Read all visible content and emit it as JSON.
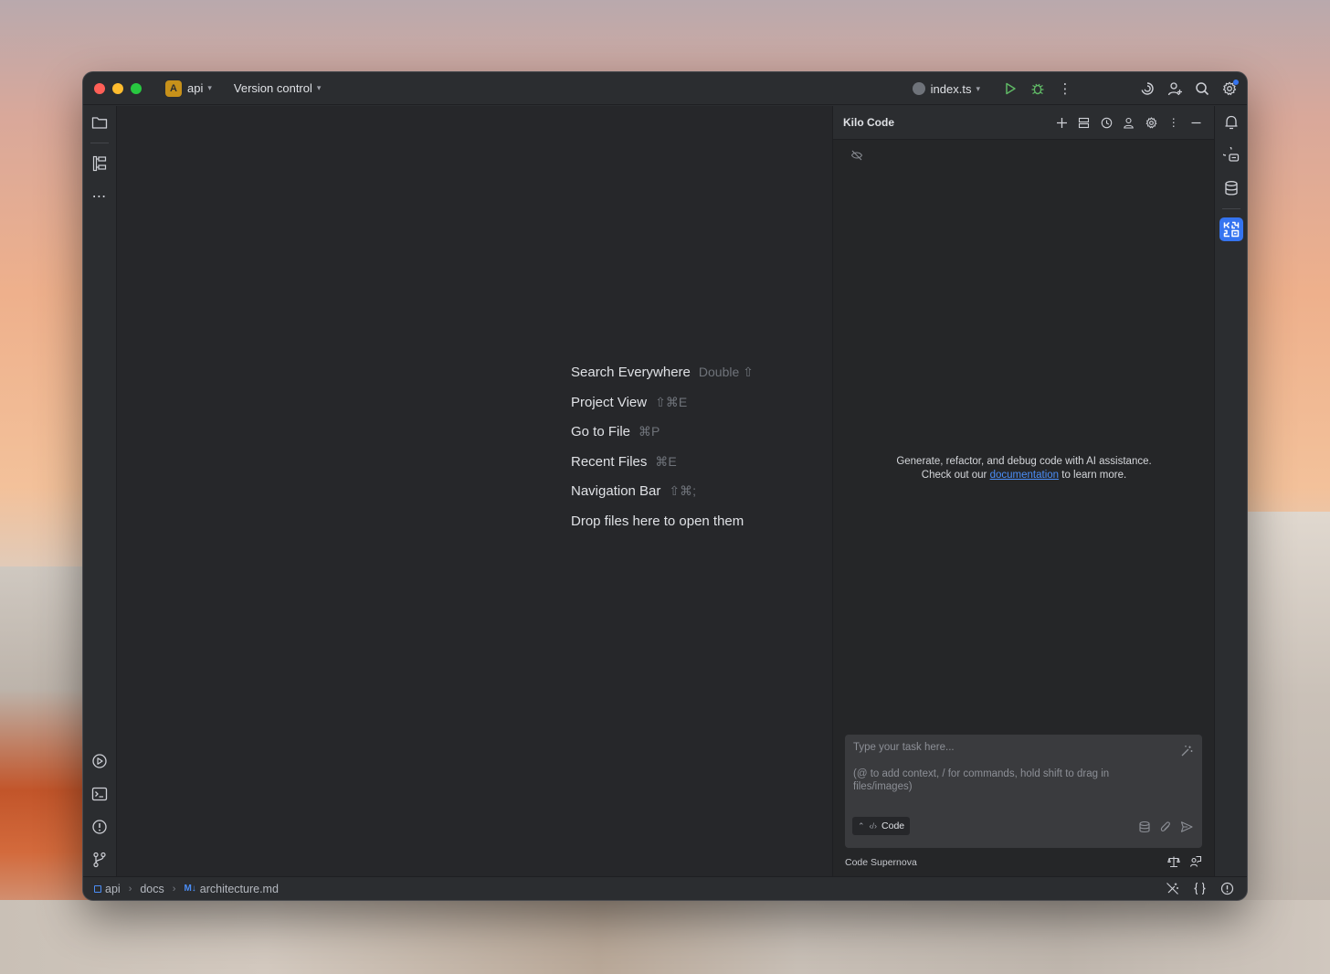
{
  "titlebar": {
    "project_badge": "A",
    "project_name": "api",
    "vcs_label": "Version control",
    "run_config": "index.ts"
  },
  "editor": {
    "hints": [
      {
        "label": "Search Everywhere",
        "shortcut": "Double ⇧"
      },
      {
        "label": "Project View",
        "shortcut": "⇧⌘E"
      },
      {
        "label": "Go to File",
        "shortcut": "⌘P"
      },
      {
        "label": "Recent Files",
        "shortcut": "⌘E"
      },
      {
        "label": "Navigation Bar",
        "shortcut": "⇧⌘;"
      },
      {
        "label": "Drop files here to open them",
        "shortcut": ""
      }
    ]
  },
  "kilo": {
    "title": "Kilo Code",
    "welcome_line1": "Generate, refactor, and debug code with AI assistance.",
    "welcome_pre": "Check out our",
    "welcome_link": "documentation",
    "welcome_post": "to learn more.",
    "task_placeholder_1": "Type your task here...",
    "task_placeholder_2": "(@ to add context, / for commands, hold shift to drag in files/images)",
    "mode_label": "Code",
    "model_label": "Code Supernova"
  },
  "statusbar": {
    "crumbs": [
      "api",
      "docs",
      "architecture.md"
    ],
    "md_badge": "M↓"
  },
  "colors": {
    "accent": "#3574f0",
    "link": "#4b8ef7",
    "run_green": "#5fb865",
    "project_badge": "#c7911a"
  }
}
